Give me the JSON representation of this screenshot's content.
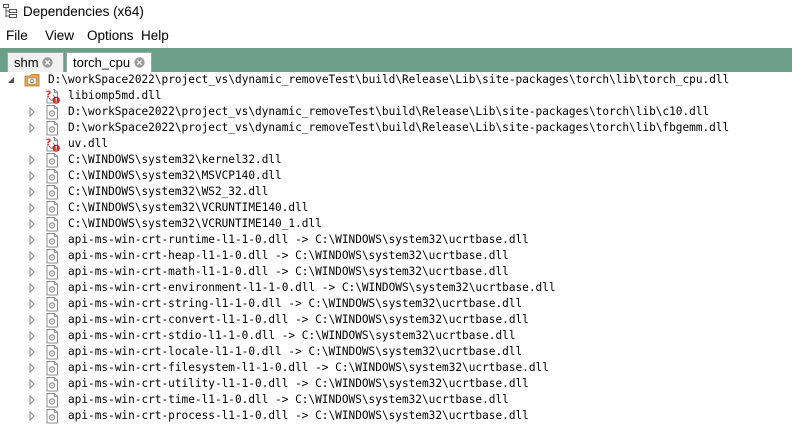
{
  "window": {
    "title": "Dependencies (x64)"
  },
  "menu": {
    "items": [
      "File",
      "View",
      "Options",
      "Help"
    ]
  },
  "tabs": [
    {
      "label": "shm",
      "active": false
    },
    {
      "label": "torch_cpu",
      "active": true
    }
  ],
  "tree": {
    "root": {
      "path": "D:\\workSpace2022\\project_vs\\dynamic_removeTest\\build\\Release\\Lib\\site-packages\\torch\\lib\\torch_cpu.dll",
      "icon": "folder-dll-icon",
      "expanded": true
    },
    "children": [
      {
        "text": "libiomp5md.dll",
        "icon": "missing-dll-icon",
        "has_children": false
      },
      {
        "text": "D:\\workSpace2022\\project_vs\\dynamic_removeTest\\build\\Release\\Lib\\site-packages\\torch\\lib\\c10.dll",
        "icon": "dll-icon",
        "has_children": true
      },
      {
        "text": "D:\\workSpace2022\\project_vs\\dynamic_removeTest\\build\\Release\\Lib\\site-packages\\torch\\lib\\fbgemm.dll",
        "icon": "dll-icon",
        "has_children": true
      },
      {
        "text": "uv.dll",
        "icon": "missing-dll-icon",
        "has_children": false
      },
      {
        "text": "C:\\WINDOWS\\system32\\kernel32.dll",
        "icon": "dll-icon",
        "has_children": true
      },
      {
        "text": "C:\\WINDOWS\\system32\\MSVCP140.dll",
        "icon": "dll-icon",
        "has_children": true
      },
      {
        "text": "C:\\WINDOWS\\system32\\WS2_32.dll",
        "icon": "dll-icon",
        "has_children": true
      },
      {
        "text": "C:\\WINDOWS\\system32\\VCRUNTIME140.dll",
        "icon": "dll-icon",
        "has_children": true
      },
      {
        "text": "C:\\WINDOWS\\system32\\VCRUNTIME140_1.dll",
        "icon": "dll-icon",
        "has_children": true
      },
      {
        "text": "api-ms-win-crt-runtime-l1-1-0.dll -> C:\\WINDOWS\\system32\\ucrtbase.dll",
        "icon": "dll-icon",
        "has_children": true
      },
      {
        "text": "api-ms-win-crt-heap-l1-1-0.dll -> C:\\WINDOWS\\system32\\ucrtbase.dll",
        "icon": "dll-icon",
        "has_children": true
      },
      {
        "text": "api-ms-win-crt-math-l1-1-0.dll -> C:\\WINDOWS\\system32\\ucrtbase.dll",
        "icon": "dll-icon",
        "has_children": true
      },
      {
        "text": "api-ms-win-crt-environment-l1-1-0.dll -> C:\\WINDOWS\\system32\\ucrtbase.dll",
        "icon": "dll-icon",
        "has_children": true
      },
      {
        "text": "api-ms-win-crt-string-l1-1-0.dll -> C:\\WINDOWS\\system32\\ucrtbase.dll",
        "icon": "dll-icon",
        "has_children": true
      },
      {
        "text": "api-ms-win-crt-convert-l1-1-0.dll -> C:\\WINDOWS\\system32\\ucrtbase.dll",
        "icon": "dll-icon",
        "has_children": true
      },
      {
        "text": "api-ms-win-crt-stdio-l1-1-0.dll -> C:\\WINDOWS\\system32\\ucrtbase.dll",
        "icon": "dll-icon",
        "has_children": true
      },
      {
        "text": "api-ms-win-crt-locale-l1-1-0.dll -> C:\\WINDOWS\\system32\\ucrtbase.dll",
        "icon": "dll-icon",
        "has_children": true
      },
      {
        "text": "api-ms-win-crt-filesystem-l1-1-0.dll -> C:\\WINDOWS\\system32\\ucrtbase.dll",
        "icon": "dll-icon",
        "has_children": true
      },
      {
        "text": "api-ms-win-crt-utility-l1-1-0.dll -> C:\\WINDOWS\\system32\\ucrtbase.dll",
        "icon": "dll-icon",
        "has_children": true
      },
      {
        "text": "api-ms-win-crt-time-l1-1-0.dll -> C:\\WINDOWS\\system32\\ucrtbase.dll",
        "icon": "dll-icon",
        "has_children": true
      },
      {
        "text": "api-ms-win-crt-process-l1-1-0.dll -> C:\\WINDOWS\\system32\\ucrtbase.dll",
        "icon": "dll-icon",
        "has_children": true
      }
    ]
  },
  "colors": {
    "tabstrip": "#6d9d8b",
    "missing_badge": "#d42020",
    "folder": "#e8a64a"
  }
}
